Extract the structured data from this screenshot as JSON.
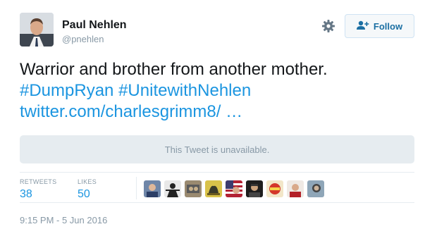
{
  "author": {
    "name": "Paul Nehlen",
    "handle": "@pnehlen"
  },
  "header": {
    "follow_label": "Follow"
  },
  "tweet": {
    "line1": "Warrior and brother from another mother.",
    "hashtag1": "#DumpRyan",
    "hashtag2": "#UnitewithNehlen",
    "link": "twitter.com/charlesgrimm8/ …"
  },
  "quoted": {
    "message": "This Tweet is unavailable."
  },
  "stats": {
    "retweets_label": "RETWEETS",
    "retweets_value": "38",
    "likes_label": "LIKES",
    "likes_value": "50"
  },
  "likers": [
    {
      "name": "liker-1"
    },
    {
      "name": "liker-2"
    },
    {
      "name": "liker-3"
    },
    {
      "name": "liker-4"
    },
    {
      "name": "liker-5"
    },
    {
      "name": "liker-6"
    },
    {
      "name": "liker-7"
    },
    {
      "name": "liker-8"
    },
    {
      "name": "liker-9"
    }
  ],
  "timestamp": "9:15 PM - 5 Jun 2016",
  "colors": {
    "link": "#1b95e0",
    "muted": "#8899a6",
    "follow_text": "#1b6fa3"
  }
}
